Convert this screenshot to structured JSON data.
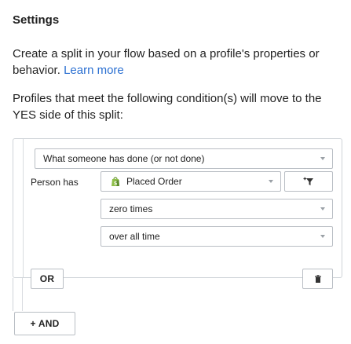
{
  "page": {
    "title": "Settings",
    "description": "Create a split in your flow based on a profile's properties or behavior.",
    "learn_more": "Learn more",
    "condition_text": "Profiles that meet the following condition(s) will move to the YES side of this split:"
  },
  "condition": {
    "type_select": "What someone has done (or not done)",
    "person_has_label": "Person has",
    "metric_select": "Placed Order",
    "frequency_select": "zero times",
    "timeframe_select": "over all time"
  },
  "buttons": {
    "or_label": "OR",
    "and_label": "+ AND"
  },
  "colors": {
    "link": "#2a6fd1",
    "border": "#b9bec4"
  },
  "icons": {
    "metric": "shopify-bag-icon",
    "filter": "add-filter-icon",
    "delete": "trash-icon"
  }
}
